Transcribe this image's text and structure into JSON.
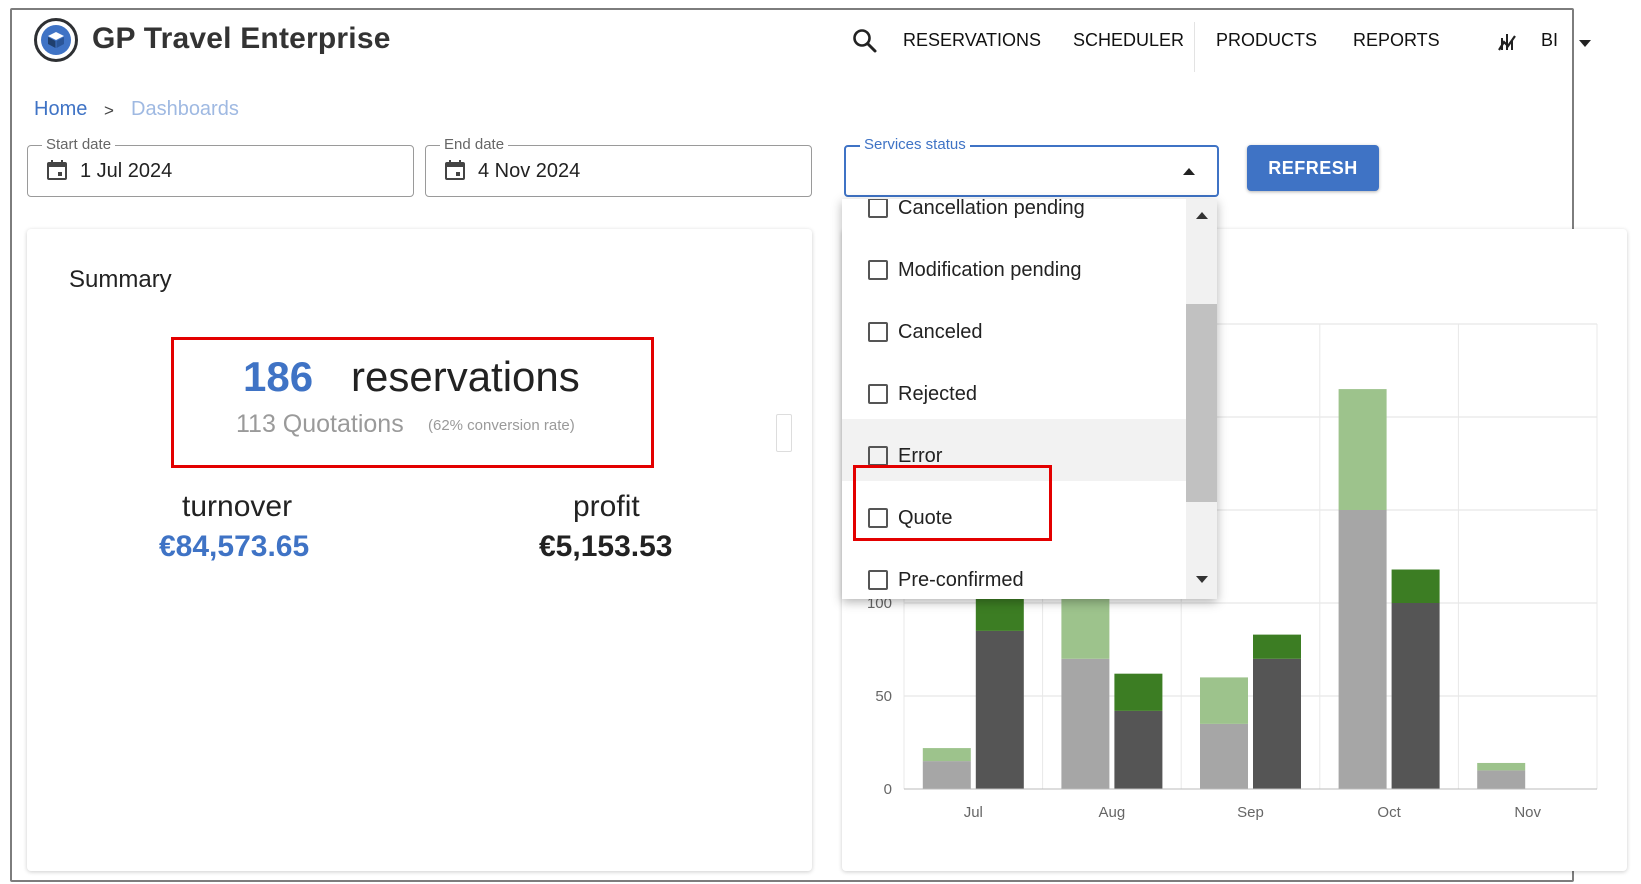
{
  "app": {
    "title": "GP Travel Enterprise",
    "accent": "#3f73c5"
  },
  "nav": {
    "search_icon": "search-icon",
    "items": [
      "RESERVATIONS",
      "SCHEDULER",
      "PRODUCTS",
      "REPORTS"
    ],
    "bi_icon": "chart-icon",
    "bi_label": "BI"
  },
  "breadcrumb": {
    "home": "Home",
    "separator": ">",
    "current": "Dashboards"
  },
  "filters": {
    "start_date": {
      "label": "Start date",
      "value": "1 Jul 2024"
    },
    "end_date": {
      "label": "End date",
      "value": "4 Nov 2024"
    },
    "services_status": {
      "label": "Services status",
      "value": ""
    },
    "refresh_label": "REFRESH"
  },
  "dropdown": {
    "options": [
      "Cancellation pending",
      "Modification pending",
      "Canceled",
      "Rejected",
      "Error",
      "Quote",
      "Pre-confirmed"
    ],
    "highlighted": "Error",
    "annotated": "Quote"
  },
  "summary": {
    "title": "Summary",
    "reservations_count": "186",
    "reservations_label": "reservations",
    "quotations": "113 Quotations",
    "conversion": "(62% conversion rate)",
    "turnover_label": "turnover",
    "turnover_value": "€84,573.65",
    "profit_label": "profit",
    "profit_value": "€5,153.53"
  },
  "chart_data": {
    "type": "bar",
    "categories": [
      "Jul",
      "Aug",
      "Sep",
      "Oct",
      "Nov"
    ],
    "y_ticks": [
      0,
      50,
      100
    ],
    "ylim": [
      0,
      250
    ],
    "grid": true,
    "series": [
      {
        "stack": "a",
        "values": [
          15,
          70,
          35,
          150,
          10
        ],
        "color": "#a6a6a6"
      },
      {
        "stack": "a",
        "values": [
          7,
          50,
          25,
          65,
          4
        ],
        "color": "#9dc38c"
      },
      {
        "stack": "b",
        "values": [
          85,
          42,
          70,
          100,
          0
        ],
        "color": "#555555"
      },
      {
        "stack": "b",
        "values": [
          25,
          20,
          13,
          18,
          0
        ],
        "color": "#3c7d23"
      }
    ]
  }
}
